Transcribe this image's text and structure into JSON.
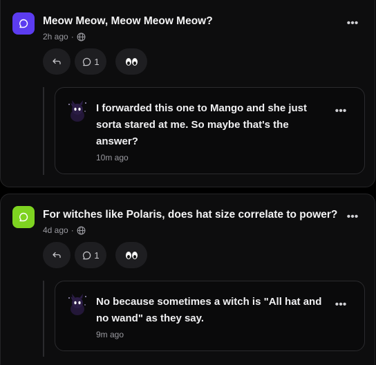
{
  "posts": [
    {
      "avatar_color": "#5b3cf0",
      "title": "Meow Meow, Meow Meow Meow?",
      "time": "2h ago",
      "separator": "·",
      "reply_count": "1",
      "reply": {
        "text": "I forwarded this one to Mango and she just sorta stared at me. So maybe that's the answer?",
        "time": "10m ago"
      }
    },
    {
      "avatar_color": "#7ed321",
      "title": "For witches like Polaris, does hat size correlate to power?",
      "time": "4d ago",
      "separator": "·",
      "reply_count": "1",
      "reply": {
        "text": "No because sometimes a witch is \"All hat and no wand\" as they say.",
        "time": "9m ago"
      }
    }
  ],
  "more_glyph": "•••",
  "icons": {
    "question": "chat-bubble-icon",
    "visibility": "globe-icon",
    "reply": "reply-arrow-icon",
    "comments": "comment-icon",
    "reaction": "eyes-icon",
    "more": "more-icon",
    "author": "witch-cat-avatar"
  }
}
